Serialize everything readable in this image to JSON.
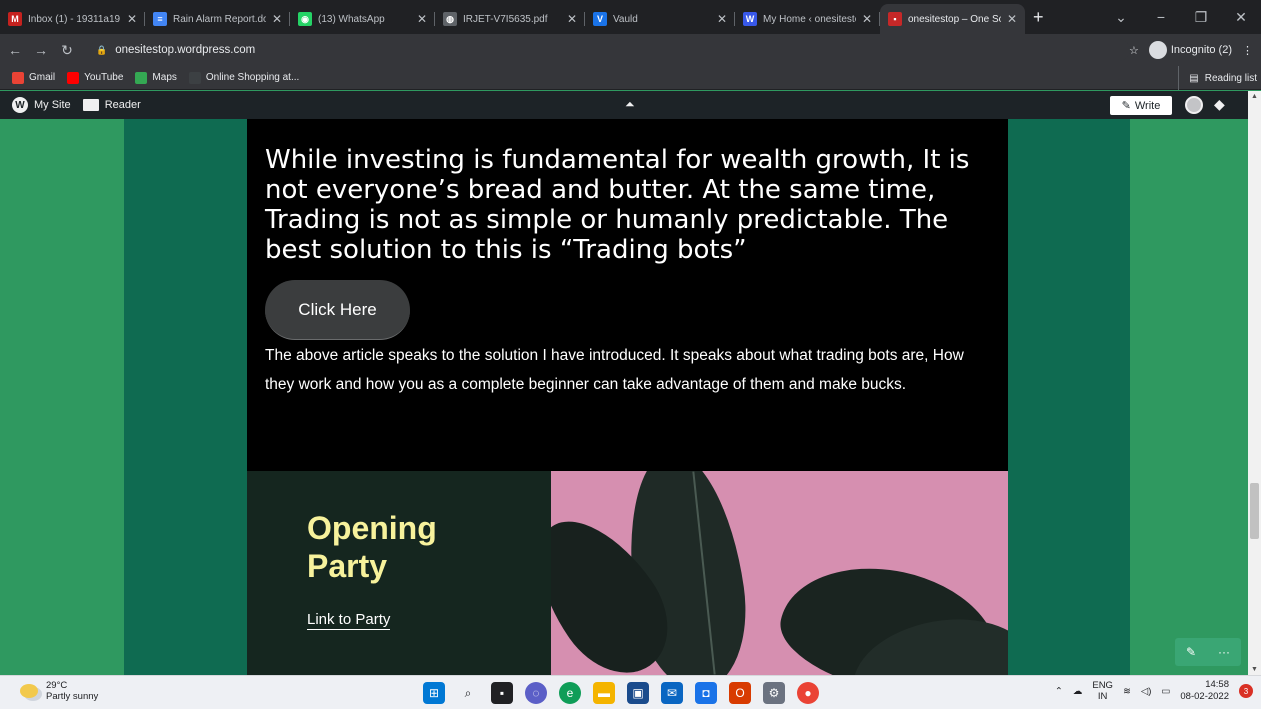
{
  "browser": {
    "tabs": [
      {
        "label": "Inbox (1) - 19311a19",
        "icon": "gmail-icon",
        "color": "#c5221f",
        "glyph": "M"
      },
      {
        "label": "Rain Alarm Report.do",
        "icon": "docs-icon",
        "color": "#4285f4",
        "glyph": "≡"
      },
      {
        "label": "(13) WhatsApp",
        "icon": "whatsapp-icon",
        "color": "#25d366",
        "glyph": "◉"
      },
      {
        "label": "IRJET-V7I5635.pdf",
        "icon": "globe-icon",
        "color": "#5f6368",
        "glyph": "◍"
      },
      {
        "label": "Vauld",
        "icon": "vauld-icon",
        "color": "#1a73e8",
        "glyph": "V"
      },
      {
        "label": "My Home ‹ onesitesto",
        "icon": "wordpress-icon",
        "color": "#3858e9",
        "glyph": "W"
      },
      {
        "label": "onesitestop – One So",
        "icon": "site-favicon-icon",
        "color": "#c62828",
        "glyph": "▪"
      }
    ],
    "new_tab": "+",
    "window_controls": {
      "dropdown": "⌄",
      "minimize": "−",
      "restore": "❐",
      "close": "✕"
    },
    "url": "onesitestop.wordpress.com",
    "incognito_label": "Incognito (2)",
    "bookmarks": [
      {
        "label": "Gmail",
        "icon": "gmail-icon",
        "color": "#ea4335"
      },
      {
        "label": "YouTube",
        "icon": "youtube-icon",
        "color": "#ff0000"
      },
      {
        "label": "Maps",
        "icon": "maps-icon",
        "color": "#34a853"
      },
      {
        "label": "Online Shopping at...",
        "icon": "shopping-icon",
        "color": "#3c4043"
      }
    ],
    "reading_list": "Reading list"
  },
  "wp_admin_bar": {
    "my_site": "My Site",
    "reader": "Reader",
    "write": "Write"
  },
  "page": {
    "headline": "While investing is fundamental for wealth growth, It is not everyone’s bread and butter. At the same time, Trading is not as simple or humanly predictable. The best solution to this is “Trading bots”",
    "cta_button": "Click Here",
    "paragraph": "The above article speaks to the solution I have introduced. It speaks about what trading bots are, How they work and how you as a complete beginner can take advantage of them and make bucks.",
    "party_title": "Opening Party",
    "party_link": "Link to Party"
  },
  "taskbar": {
    "temperature": "29°C",
    "weather": "Partly sunny",
    "language": "ENG",
    "region": "IN",
    "time": "14:58",
    "date": "08-02-2022",
    "notification_count": "3"
  }
}
